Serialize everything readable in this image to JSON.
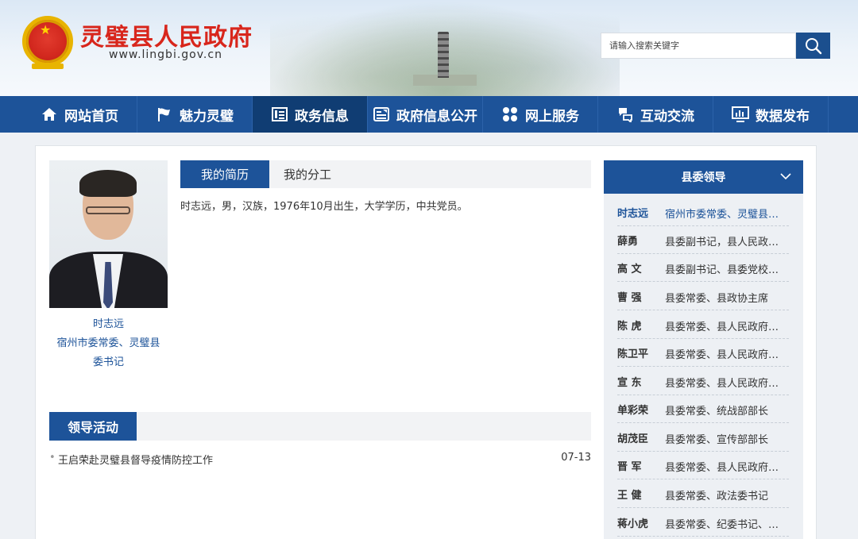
{
  "header": {
    "title": "灵璧县人民政府",
    "url": "www.lingbi.gov.cn",
    "emblem_icon": "national-emblem",
    "search_placeholder": "请输入搜索关键字",
    "search_icon": "magnifier-icon"
  },
  "nav": {
    "items": [
      {
        "label": "网站首页",
        "icon": "home-icon"
      },
      {
        "label": "魅力灵璧",
        "icon": "flag-icon"
      },
      {
        "label": "政务信息",
        "icon": "list-icon",
        "active": true
      },
      {
        "label": "政府信息公开",
        "icon": "document-icon"
      },
      {
        "label": "网上服务",
        "icon": "grid-icon"
      },
      {
        "label": "互动交流",
        "icon": "chat-icon"
      },
      {
        "label": "数据发布",
        "icon": "monitor-chart-icon"
      }
    ]
  },
  "profile": {
    "name": "时志远",
    "position_line1": "宿州市委常委、灵璧县",
    "position_line2": "委书记",
    "tabs": [
      "我的简历",
      "我的分工"
    ],
    "bio": "时志远，男，汉族，1976年10月出生，大学学历，中共党员。"
  },
  "activities": {
    "title": "领导活动",
    "items": [
      {
        "text": "王启荣赴灵璧县督导疫情防控工作",
        "date": "07-13"
      }
    ]
  },
  "sidebar": {
    "title": "县委领导",
    "leaders": [
      {
        "name": "时志远",
        "post": "宿州市委常委、灵璧县委书记",
        "active": true
      },
      {
        "name": "薛勇",
        "post": "县委副书记，县人民政府县长"
      },
      {
        "name": "高 文",
        "post": "县委副书记、县委党校校长"
      },
      {
        "name": "曹 强",
        "post": "县委常委、县政协主席"
      },
      {
        "name": "陈 虎",
        "post": "县委常委、县人民政府副县长"
      },
      {
        "name": "陈卫平",
        "post": "县委常委、县人民政府副县长"
      },
      {
        "name": "宣 东",
        "post": "县委常委、县人民政府副县长"
      },
      {
        "name": "单彩荣",
        "post": "县委常委、统战部部长"
      },
      {
        "name": "胡茂臣",
        "post": "县委常委、宣传部部长"
      },
      {
        "name": "晋 军",
        "post": "县委常委、县人民政府副县长"
      },
      {
        "name": "王 健",
        "post": "县委常委、政法委书记"
      },
      {
        "name": "蒋小虎",
        "post": "县委常委、纪委书记、…"
      }
    ]
  },
  "colors": {
    "nav_bg": "#1d5399",
    "nav_active": "#103d73",
    "title_red": "#d8261c",
    "link_blue": "#1d5399"
  }
}
